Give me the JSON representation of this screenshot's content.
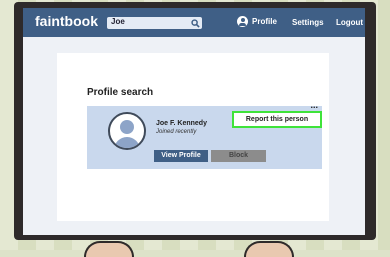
{
  "navbar": {
    "brand": "faintbook",
    "search_value": "Joe",
    "links": [
      "Profile",
      "Settings",
      "Logout"
    ]
  },
  "main": {
    "title": "Profile search",
    "result": {
      "name": "Joe F. Kennedy",
      "subtitle": "Joined recently",
      "more": "...",
      "report_label": "Report this person",
      "view_label": "View Profile",
      "block_label": "Block"
    }
  },
  "colors": {
    "nav_bg": "#3f5f86",
    "card_bg": "#c9d8ed",
    "report_border": "#3fe33a",
    "block_bg": "#8c8c8c"
  }
}
